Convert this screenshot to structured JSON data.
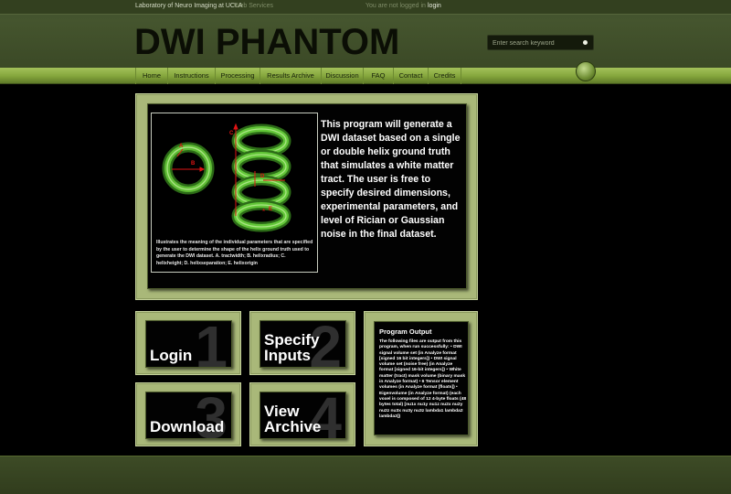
{
  "topbar": {
    "lab_link": "Laboratory of Neuro Imaging at UCLA",
    "web_services": "Web Services",
    "login_status": "You are not logged in",
    "login_link": "login"
  },
  "header": {
    "title": "DWI PHANTOM",
    "search_placeholder": "Enter search keyword"
  },
  "nav": {
    "items": [
      "Home",
      "Instructions",
      "Processing",
      "Results Archive",
      "Discussion",
      "FAQ",
      "Contact",
      "Credits"
    ]
  },
  "intro": {
    "figure_labels": [
      "A",
      "B",
      "C",
      "D",
      "E"
    ],
    "figure_caption": "Illustrates the meaning of the individual parameters that are specified by the user to determine the shape of the helix ground truth used to generate the DWI dataset. A. tractwidth; B. helixradius; C. helixheight; D. helixseparation; E. helixorigin",
    "text": "This program will generate a DWI dataset based on a single or double helix ground truth that simulates a white matter tract. The user is free to specify desired dimensions, experimental parameters, and level of Rician or Gaussian noise in the final dataset."
  },
  "cards": [
    {
      "label": "Login",
      "number": "1"
    },
    {
      "label": "Specify Inputs",
      "number": "2"
    },
    {
      "label": "Download",
      "number": "3"
    },
    {
      "label": "View Archive",
      "number": "4"
    }
  ],
  "output": {
    "title": "Program Output",
    "text": "The following files are output from this program, when run successfully: • DWI signal volume set (in Analyze format [signed 16 bit integers]) • DWI signal volume set (noise free) (in Analyze format [signed 16-bit integers]) • White matter (tract) mask volume (binary mask in Analyze format) • 6 Tensor element volumes (in Analyze format [floats]) • Eigenvolume (in Analyze format) (each voxel is composed of 12 4-byte floats (48 bytes total) [nu1x nu1y nu1z nu2x nu2y nu2z nu3x nu3y nu3z lambda1 lambda2 lambda3])"
  },
  "colors": {
    "header_bg": "#45552e",
    "nav_green": "#8fb046",
    "panel_green": "#a9b879",
    "helix_green": "#5fc238",
    "annotation_red": "#e01414"
  }
}
